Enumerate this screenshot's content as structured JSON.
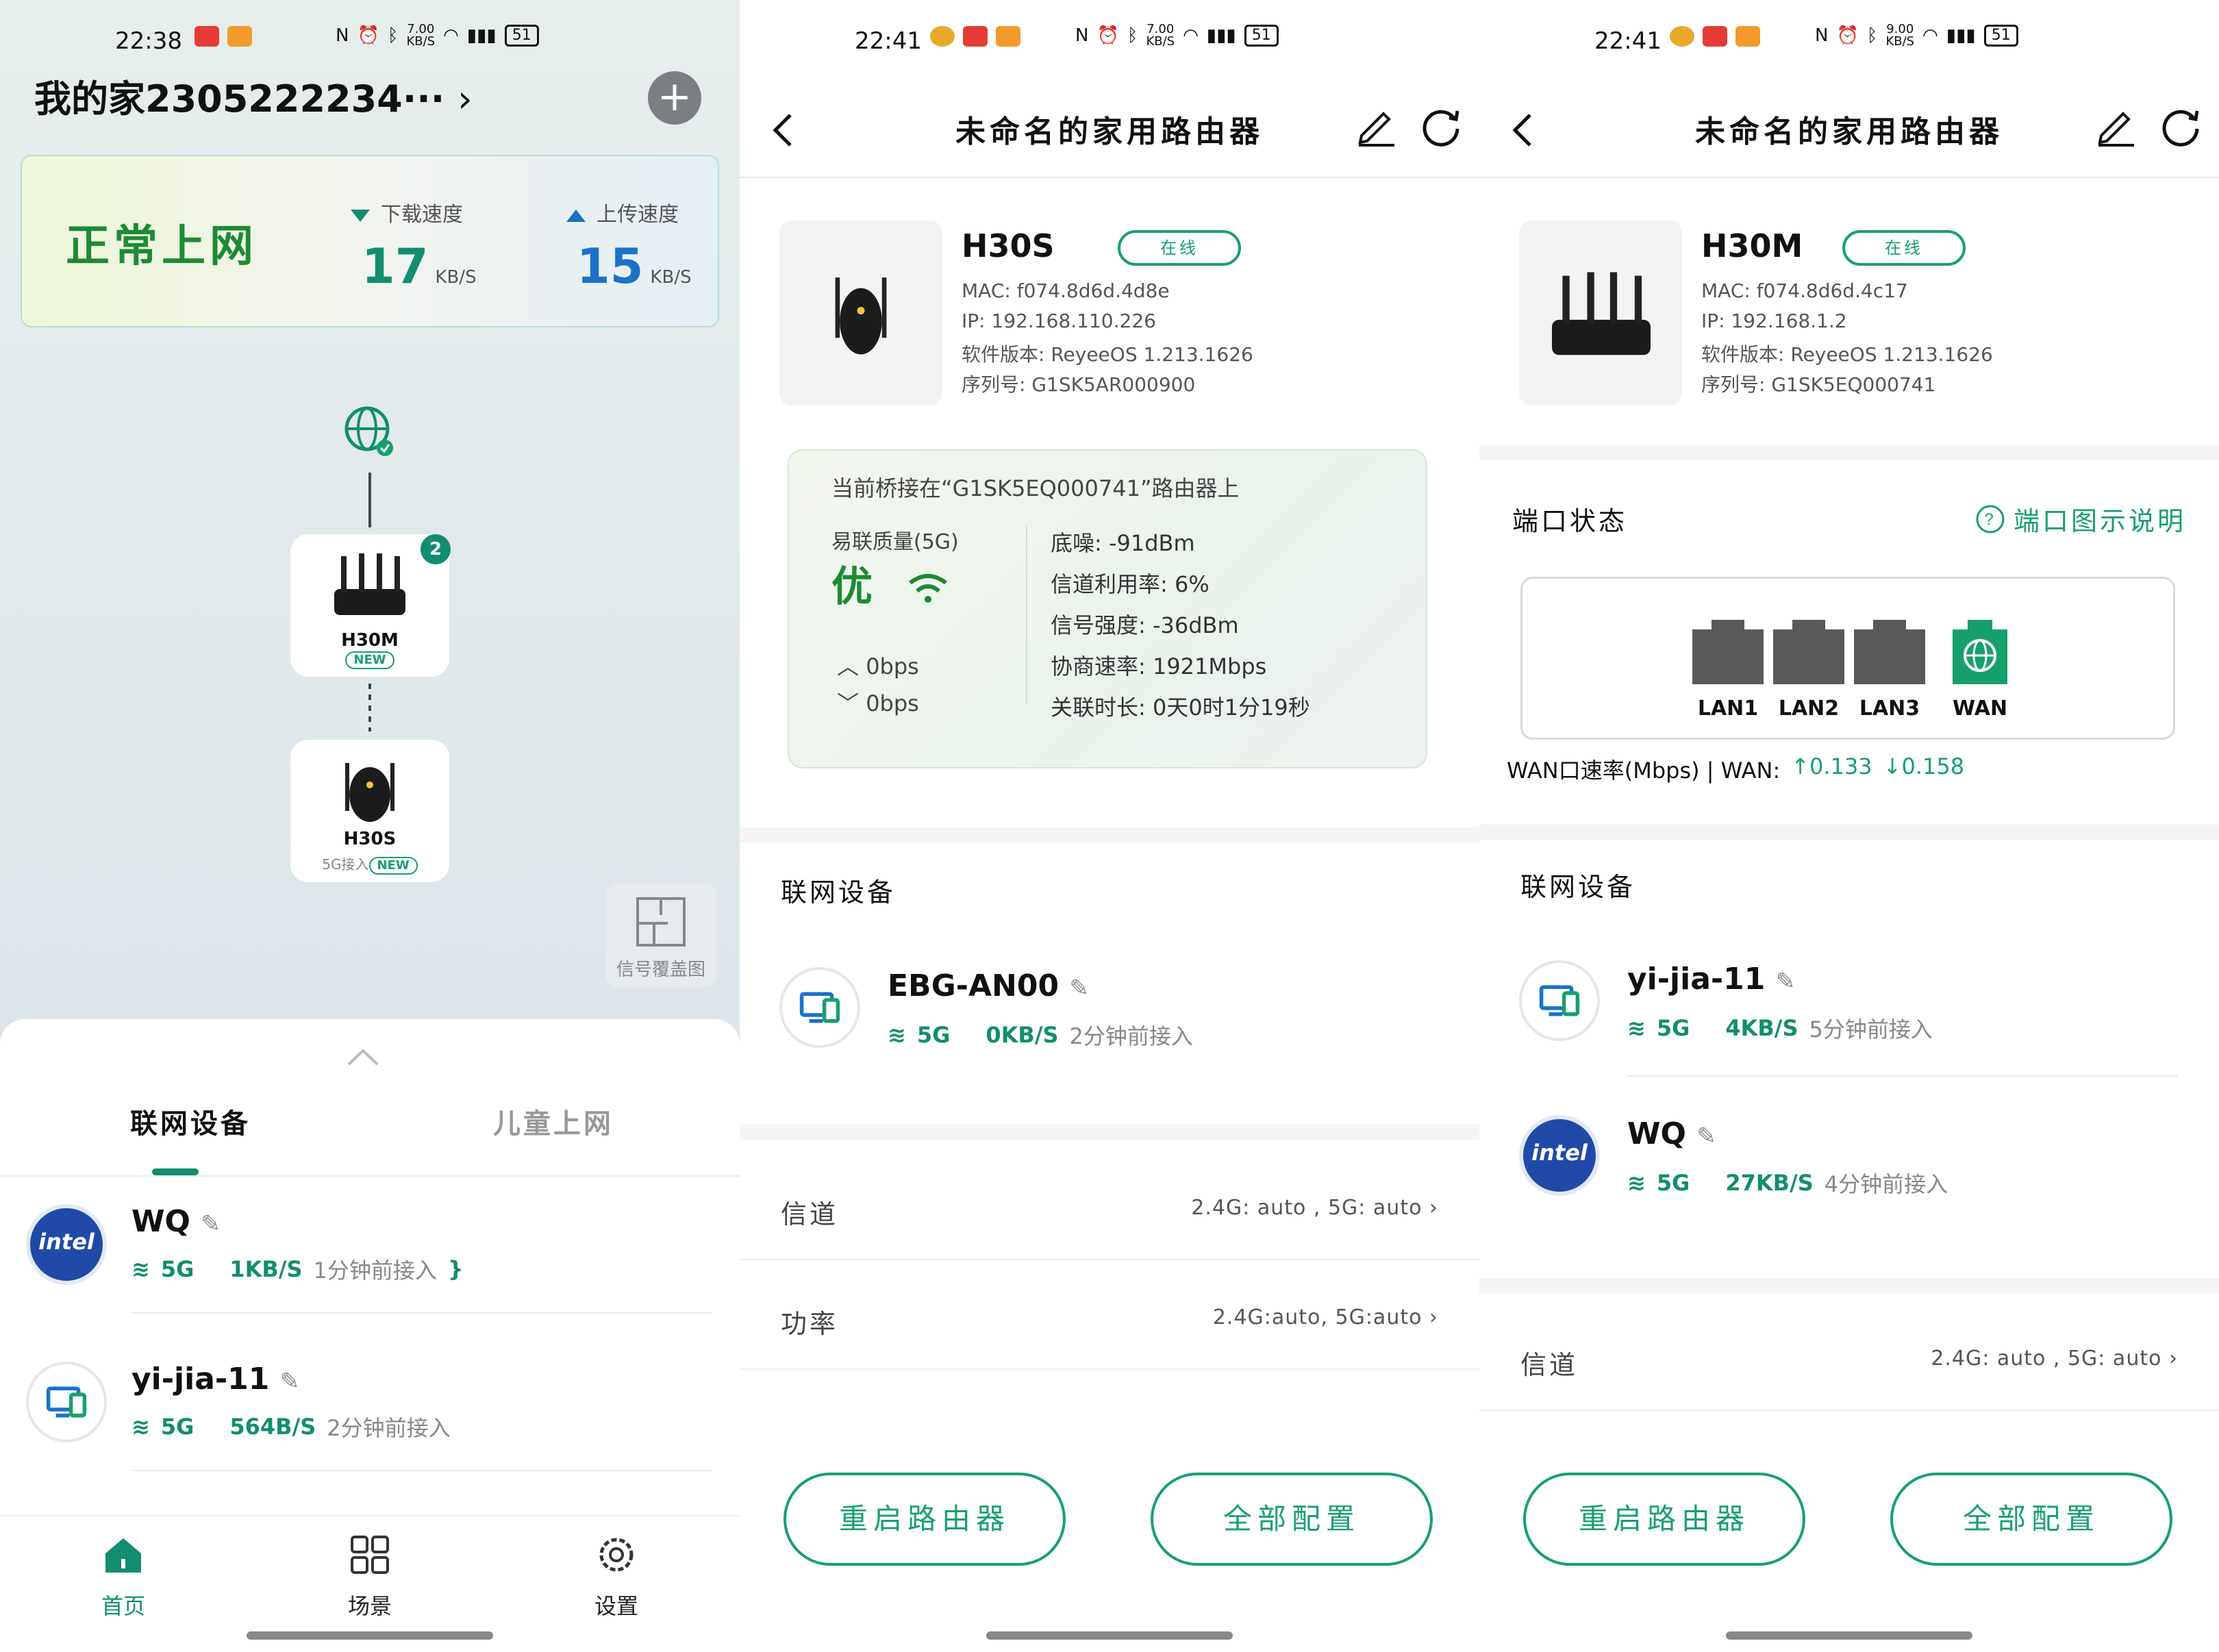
{
  "p1": {
    "status": {
      "time": "22:38",
      "speed_top": "7.00",
      "speed_bot": "KB/S",
      "battery": "51"
    },
    "home_title": "我的家2305222234···",
    "add_icon": "plus-icon",
    "net": {
      "status": "正常上网",
      "download_label": "下载速度",
      "download_value": "17",
      "download_unit": "KB/S",
      "upload_label": "上传速度",
      "upload_value": "15",
      "upload_unit": "KB/S"
    },
    "topology": [
      {
        "name": "H30M",
        "badge": "NEW",
        "count": "2",
        "sub": ""
      },
      {
        "name": "H30S",
        "badge": "NEW",
        "sub": "5G接入"
      }
    ],
    "coverage_label": "信号覆盖图",
    "tabs": [
      "联网设备",
      "儿童上网"
    ],
    "devices": [
      {
        "name": "WQ",
        "band": "5G",
        "speed": "1KB/S",
        "time": "1分钟前接入",
        "avatar": "intel"
      },
      {
        "name": "yi-jia-11",
        "band": "5G",
        "speed": "564B/S",
        "time": "2分钟前接入",
        "avatar": "pc"
      }
    ],
    "nav": [
      {
        "label": "首页",
        "icon": "home-icon"
      },
      {
        "label": "场景",
        "icon": "grid-icon"
      },
      {
        "label": "设置",
        "icon": "gear-icon"
      }
    ],
    "colors": {
      "accent": "#128d6f",
      "online": "#18a06c",
      "upload": "#1a72c9"
    }
  },
  "p2": {
    "status": {
      "time": "22:41",
      "speed_top": "7.00",
      "speed_bot": "KB/S",
      "battery": "51"
    },
    "title": "未命名的家用路由器",
    "device": {
      "model": "H30S",
      "online": "在线",
      "mac": "MAC: f074.8d6d.4d8e",
      "ip": "IP: 192.168.110.226",
      "fw": "软件版本: ReyeeOS 1.213.1626",
      "sn": "序列号: G1SK5AR000900"
    },
    "bridge": {
      "title": "当前桥接在“G1SK5EQ000741”路由器上",
      "quality_label": "易联质量(5G)",
      "grade": "优",
      "up": "0bps",
      "down": "0bps",
      "stats": [
        "底噪: -91dBm",
        "信道利用率: 6%",
        "信号强度: -36dBm",
        "协商速率: 1921Mbps",
        "关联时长: 0天0时1分19秒"
      ]
    },
    "devices_title": "联网设备",
    "devices": [
      {
        "name": "EBG-AN00",
        "band": "5G",
        "speed": "0KB/S",
        "time": "2分钟前接入",
        "avatar": "pc"
      }
    ],
    "rows": [
      {
        "label": "信道",
        "value": "2.4G: auto , 5G: auto"
      },
      {
        "label": "功率",
        "value": "2.4G:auto, 5G:auto"
      }
    ],
    "buttons": [
      "重启路由器",
      "全部配置"
    ]
  },
  "p3": {
    "status": {
      "time": "22:41",
      "speed_top": "9.00",
      "speed_bot": "KB/S",
      "battery": "51"
    },
    "title": "未命名的家用路由器",
    "device": {
      "model": "H30M",
      "online": "在线",
      "mac": "MAC: f074.8d6d.4c17",
      "ip": "IP: 192.168.1.2",
      "fw": "软件版本: ReyeeOS 1.213.1626",
      "sn": "序列号: G1SK5EQ000741"
    },
    "port_title": "端口状态",
    "port_help": "端口图示说明",
    "ports": [
      {
        "label": "LAN1",
        "active": false
      },
      {
        "label": "LAN2",
        "active": false
      },
      {
        "label": "LAN3",
        "active": false
      },
      {
        "label": "WAN",
        "active": true
      }
    ],
    "wan": {
      "label": "WAN口速率(Mbps) | WAN:",
      "up": "↑0.133",
      "down": "↓0.158"
    },
    "devices_title": "联网设备",
    "devices": [
      {
        "name": "yi-jia-11",
        "band": "5G",
        "speed": "4KB/S",
        "time": "5分钟前接入",
        "avatar": "pc"
      },
      {
        "name": "WQ",
        "band": "5G",
        "speed": "27KB/S",
        "time": "4分钟前接入",
        "avatar": "intel"
      }
    ],
    "rows": [
      {
        "label": "信道",
        "value": "2.4G: auto , 5G: auto"
      }
    ],
    "buttons": [
      "重启路由器",
      "全部配置"
    ]
  }
}
